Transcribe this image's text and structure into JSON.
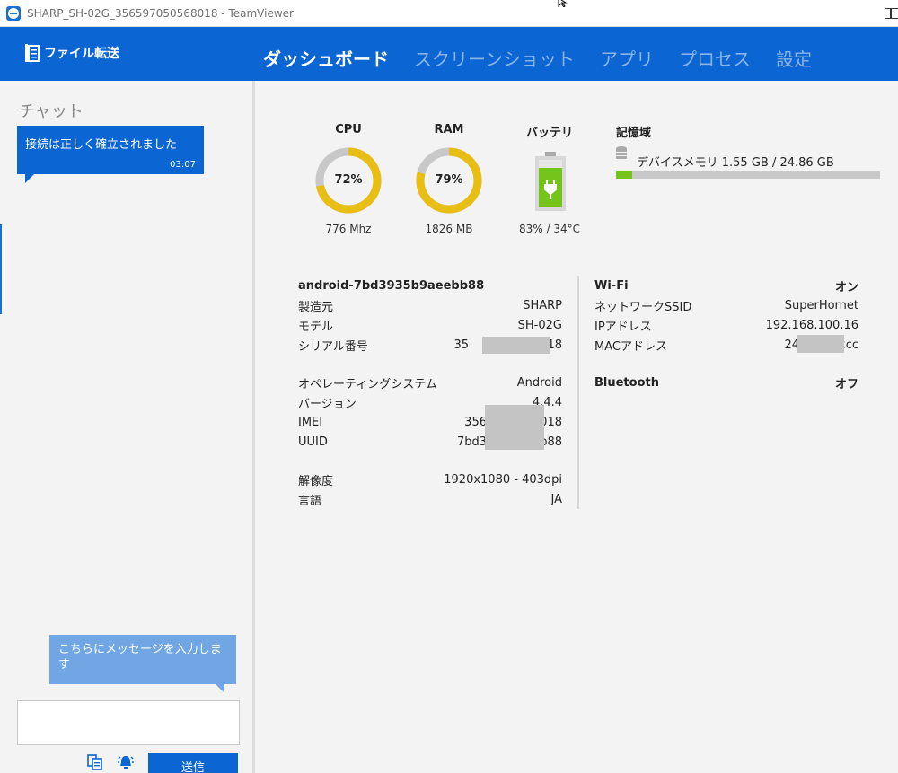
{
  "window": {
    "title": "SHARP_SH-02G_356597050568018 - TeamViewer"
  },
  "header": {
    "file_transfer": "ファイル転送",
    "tabs": [
      "ダッシュボード",
      "スクリーンショット",
      "アプリ",
      "プロセス",
      "設定"
    ]
  },
  "chat": {
    "title": "チャット",
    "message": {
      "text": "接続は正しく確立されました",
      "time": "03:07"
    },
    "hint": "こちらにメッセージを入力します",
    "input_value": "",
    "send_label": "送信"
  },
  "dashboard": {
    "cpu": {
      "label": "CPU",
      "percent": 72,
      "percent_text": "72%",
      "detail": "776 Mhz"
    },
    "ram": {
      "label": "RAM",
      "percent": 79,
      "percent_text": "79%",
      "detail": "1826 MB"
    },
    "battery": {
      "label": "バッテリ",
      "level": 83,
      "detail": "83% / 34°C"
    },
    "storage": {
      "title": "記憶域",
      "text": "デバイスメモリ 1.55 GB / 24.86 GB",
      "used_fraction": 0.0623
    },
    "device": {
      "name": "android-7bd3935b9aeebb88",
      "manufacturer_label": "製造元",
      "manufacturer": "SHARP",
      "model_label": "モデル",
      "model": "SH-02G",
      "serial_label": "シリアル番号",
      "serial_prefix": "35",
      "serial_suffix": "18",
      "os_label": "オペレーティングシステム",
      "os": "Android",
      "version_label": "バージョン",
      "version": "4.4.4",
      "imei_label": "IMEI",
      "imei_prefix": "356",
      "imei_suffix": "018",
      "uuid_label": "UUID",
      "uuid_prefix": "7bd3",
      "uuid_suffix": "b88",
      "resolution_label": "解像度",
      "resolution": "1920x1080 - 403dpi",
      "language_label": "言語",
      "language": "JA"
    },
    "network": {
      "wifi_label": "Wi-Fi",
      "wifi_state": "オン",
      "ssid_label": "ネットワークSSID",
      "ssid": "SuperHornet",
      "ip_label": "IPアドレス",
      "ip": "192.168.100.16",
      "mac_label": "MACアドレス",
      "mac_prefix": "24",
      "mac_suffix": "2cc",
      "bt_label": "Bluetooth",
      "bt_state": "オフ"
    }
  }
}
